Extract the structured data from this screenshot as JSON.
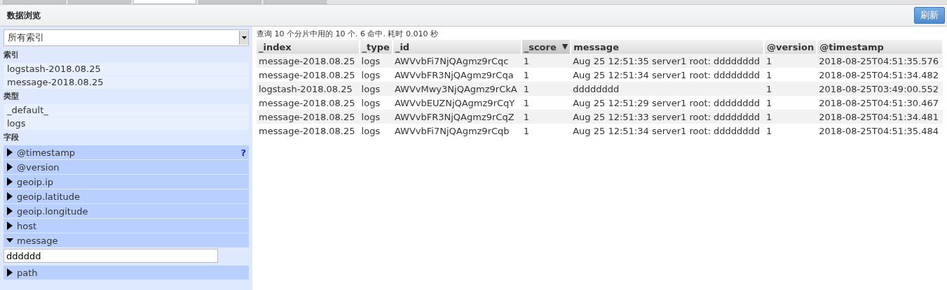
{
  "tabs": [
    {
      "selected": false
    },
    {
      "selected": false
    },
    {
      "selected": true
    },
    {
      "selected": false
    },
    {
      "selected": false
    }
  ],
  "title": "数据浏览",
  "refresh_button": "刷新",
  "sidebar": {
    "index_select": "所有索引",
    "sections": [
      {
        "heading": "索引",
        "kind": "list",
        "items": [
          "logstash-2018.08.25",
          "message-2018.08.25"
        ]
      },
      {
        "heading": "类型",
        "kind": "list",
        "items": [
          "_default_",
          "logs"
        ]
      },
      {
        "heading": "字段",
        "kind": "fields",
        "fields": [
          {
            "name": "@timestamp",
            "expanded": false,
            "help": "?"
          },
          {
            "name": "@version",
            "expanded": false
          },
          {
            "name": "geoip.ip",
            "expanded": false
          },
          {
            "name": "geoip.latitude",
            "expanded": false
          },
          {
            "name": "geoip.longitude",
            "expanded": false
          },
          {
            "name": "host",
            "expanded": false
          },
          {
            "name": "message",
            "expanded": true,
            "value": "dddddd"
          },
          {
            "name": "path",
            "expanded": false
          }
        ]
      }
    ]
  },
  "summary": "查询 10 个分片中用的 10 个. 6 命中. 耗时 0.010 秒",
  "table": {
    "columns": [
      {
        "label": "_index",
        "sorted": false
      },
      {
        "label": "_type",
        "sorted": false
      },
      {
        "label": "_id",
        "sorted": false
      },
      {
        "label": "_score",
        "sorted": true,
        "sort_icon": "▼"
      },
      {
        "label": "message",
        "sorted": false
      },
      {
        "label": "@version",
        "sorted": false
      },
      {
        "label": "@timestamp",
        "sorted": false
      }
    ],
    "rows": [
      [
        "message-2018.08.25",
        "logs",
        "AWVvbFi7NjQAgmz9rCqc",
        "1",
        "Aug 25 12:51:35 server1 root: dddddddd",
        "1",
        "2018-08-25T04:51:35.576"
      ],
      [
        "message-2018.08.25",
        "logs",
        "AWVvbFR3NjQAgmz9rCqa",
        "1",
        "Aug 25 12:51:34 server1 root: dddddddd",
        "1",
        "2018-08-25T04:51:34.482"
      ],
      [
        "logstash-2018.08.25",
        "logs",
        "AWVvMwy3NjQAgmz9rCkA",
        "1",
        "dddddddd",
        "1",
        "2018-08-25T03:49:00.552"
      ],
      [
        "message-2018.08.25",
        "logs",
        "AWVvbEUZNjQAgmz9rCqY",
        "1",
        "Aug 25 12:51:29 server1 root: dddddddd",
        "1",
        "2018-08-25T04:51:30.467"
      ],
      [
        "message-2018.08.25",
        "logs",
        "AWVvbFR3NjQAgmz9rCqZ",
        "1",
        "Aug 25 12:51:33 server1 root: dddddddd",
        "1",
        "2018-08-25T04:51:34.481"
      ],
      [
        "message-2018.08.25",
        "logs",
        "AWVvbFi7NjQAgmz9rCqb",
        "1",
        "Aug 25 12:51:34 server1 root: dddddddd",
        "1",
        "2018-08-25T04:51:35.484"
      ]
    ]
  }
}
